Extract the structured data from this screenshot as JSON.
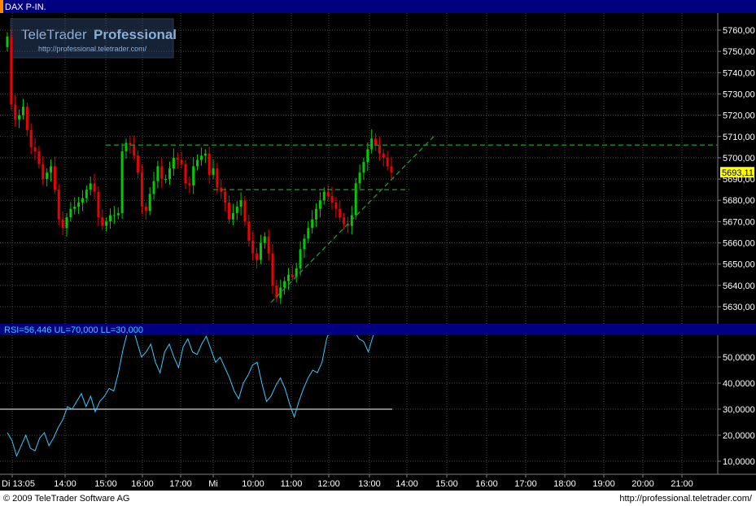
{
  "header": {
    "symbol": "DAX P-IN.",
    "brand": "TeleTrader",
    "brand_bold": "Professional",
    "brand_url": "http://professional.teletrader.com/"
  },
  "rsi_label": "RSI=56,446 UL=70,000 LL=30,000",
  "footer": {
    "copyright": "© 2009 TeleTrader Software AG",
    "url": "http://professional.teletrader.com/"
  },
  "colors": {
    "up": "#00cc00",
    "down": "#ee0000",
    "rsi": "#33ccff",
    "grid": "#4a4a4a",
    "dashed_green": "#1f9a1f",
    "panel_bar": "#000080",
    "price_tag": "#ffff00"
  },
  "chart_data": [
    {
      "type": "candlestick",
      "title": "DAX P-IN.",
      "ylim": [
        5624,
        5766
      ],
      "yticks": [
        "5630,00",
        "5640,00",
        "5650,00",
        "5660,00",
        "5670,00",
        "5680,00",
        "5690,00",
        "5700,00",
        "5710,00",
        "5720,00",
        "5730,00",
        "5740,00",
        "5750,00",
        "5760,00"
      ],
      "last_price": "5693,11",
      "xticks": [
        "Di 13:05",
        "14:00",
        "15:00",
        "16:00",
        "17:00",
        "Mi",
        "10:00",
        "11:00",
        "12:00",
        "13:00",
        "14:00",
        "15:00",
        "16:00",
        "17:00",
        "18:00",
        "19:00",
        "20:00",
        "21:00"
      ],
      "close": [
        5757,
        5725,
        5718,
        5720,
        5724,
        5713,
        5705,
        5703,
        5697,
        5690,
        5693,
        5696,
        5685,
        5671,
        5667,
        5672,
        5676,
        5677,
        5679,
        5681,
        5685,
        5688,
        5684,
        5672,
        5668,
        5670,
        5673,
        5673,
        5674,
        5703,
        5707,
        5706,
        5701,
        5693,
        5677,
        5675,
        5683,
        5689,
        5696,
        5690,
        5690,
        5695,
        5700,
        5699,
        5697,
        5688,
        5687,
        5696,
        5699,
        5701,
        5702,
        5692,
        5695,
        5686,
        5684,
        5679,
        5671,
        5674,
        5677,
        5680,
        5670,
        5661,
        5655,
        5652,
        5660,
        5663,
        5655,
        5640,
        5634,
        5639,
        5642,
        5645,
        5644,
        5648,
        5657,
        5662,
        5667,
        5671,
        5676,
        5680,
        5684,
        5682,
        5679,
        5676,
        5672,
        5669,
        5668,
        5673,
        5688,
        5693,
        5698,
        5704,
        5709,
        5706,
        5702,
        5700,
        5696,
        5693
      ],
      "lines": [
        {
          "style": "dashed",
          "name": "resistance",
          "x_from": "15:00",
          "y": 5706
        },
        {
          "style": "dashed",
          "name": "support",
          "x_from": "Mi",
          "x_to": "14:00",
          "y": 5685
        },
        {
          "style": "dashed",
          "name": "trendline",
          "from_price": 5632,
          "to_price": 5710
        }
      ]
    },
    {
      "type": "line",
      "series": [
        {
          "name": "RSI",
          "values": [
            21,
            18,
            12,
            16,
            20,
            15,
            14,
            19,
            21,
            16,
            19,
            23,
            26,
            31,
            30,
            33,
            36,
            31,
            35,
            29,
            33,
            35,
            38,
            37,
            44,
            53,
            60,
            62,
            56,
            50,
            52,
            55,
            48,
            44,
            52,
            55,
            50,
            46,
            54,
            57,
            52,
            51,
            55,
            58,
            53,
            48,
            50,
            46,
            42,
            37,
            34,
            40,
            43,
            47,
            48,
            40,
            33,
            35,
            39,
            42,
            38,
            32,
            27,
            33,
            38,
            42,
            45,
            44,
            48,
            57,
            62,
            68,
            72,
            70,
            66,
            60,
            57,
            56,
            52,
            58,
            62,
            66,
            70,
            72
          ]
        }
      ],
      "ylim": [
        4,
        58
      ],
      "yticks": [
        "10,0000",
        "20,0000",
        "30,0000",
        "40,0000",
        "50,0000"
      ],
      "reference_line": 30
    }
  ]
}
